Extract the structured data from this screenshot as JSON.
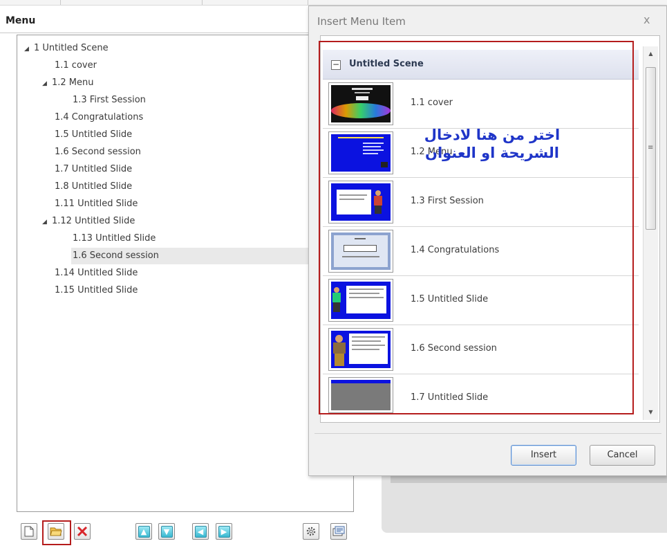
{
  "menu_panel": {
    "title": "Menu",
    "tree": [
      {
        "label": "1 Untitled Scene",
        "expanded": true
      },
      {
        "label": "1.1 cover"
      },
      {
        "label": "1.2 Menu",
        "expanded": true
      },
      {
        "label": "1.3 First Session"
      },
      {
        "label": "1.4 Congratulations"
      },
      {
        "label": "1.5 Untitled Slide"
      },
      {
        "label": "1.6 Second session"
      },
      {
        "label": "1.7 Untitled Slide"
      },
      {
        "label": "1.8 Untitled Slide"
      },
      {
        "label": "1.11 Untitled Slide"
      },
      {
        "label": "1.12 Untitled Slide",
        "expanded": true
      },
      {
        "label": "1.13 Untitled Slide"
      },
      {
        "label": "1.6 Second session",
        "selected": true
      },
      {
        "label": "1.14 Untitled Slide"
      },
      {
        "label": "1.15 Untitled Slide"
      }
    ],
    "toolbar": [
      {
        "icon": "new-page-icon"
      },
      {
        "icon": "open-folder-icon",
        "highlighted": true
      },
      {
        "icon": "delete-x-icon"
      },
      {
        "icon": "arrow-up-icon"
      },
      {
        "icon": "arrow-down-icon"
      },
      {
        "icon": "arrow-left-icon"
      },
      {
        "icon": "arrow-right-icon"
      },
      {
        "icon": "settings-gear-icon"
      },
      {
        "icon": "slides-icon"
      }
    ]
  },
  "dialog": {
    "title": "Insert Menu Item",
    "close_glyph": "x",
    "scene": {
      "label": "Untitled Scene",
      "toggle": "−"
    },
    "items": [
      {
        "label": "1.1 cover",
        "thumb": "dark-colorful"
      },
      {
        "label": "1.2 Menu",
        "thumb": "blue-text"
      },
      {
        "label": "1.3 First Session",
        "thumb": "blue-white-person"
      },
      {
        "label": "1.4 Congratulations",
        "thumb": "certificate"
      },
      {
        "label": "1.5 Untitled Slide",
        "thumb": "blue-person-left"
      },
      {
        "label": "1.6 Second session",
        "thumb": "blue-person-big"
      },
      {
        "label": "1.7 Untitled Slide",
        "thumb": "gray"
      }
    ],
    "annotation": {
      "line1": "اختر من هنا لادخال",
      "line2": "الشريحة او العنوان"
    },
    "buttons": {
      "insert": "Insert",
      "cancel": "Cancel"
    }
  },
  "colors": {
    "highlight_red": "#b51c1c",
    "annotation_blue": "#1f35c8",
    "slide_blue": "#0b12e0"
  }
}
